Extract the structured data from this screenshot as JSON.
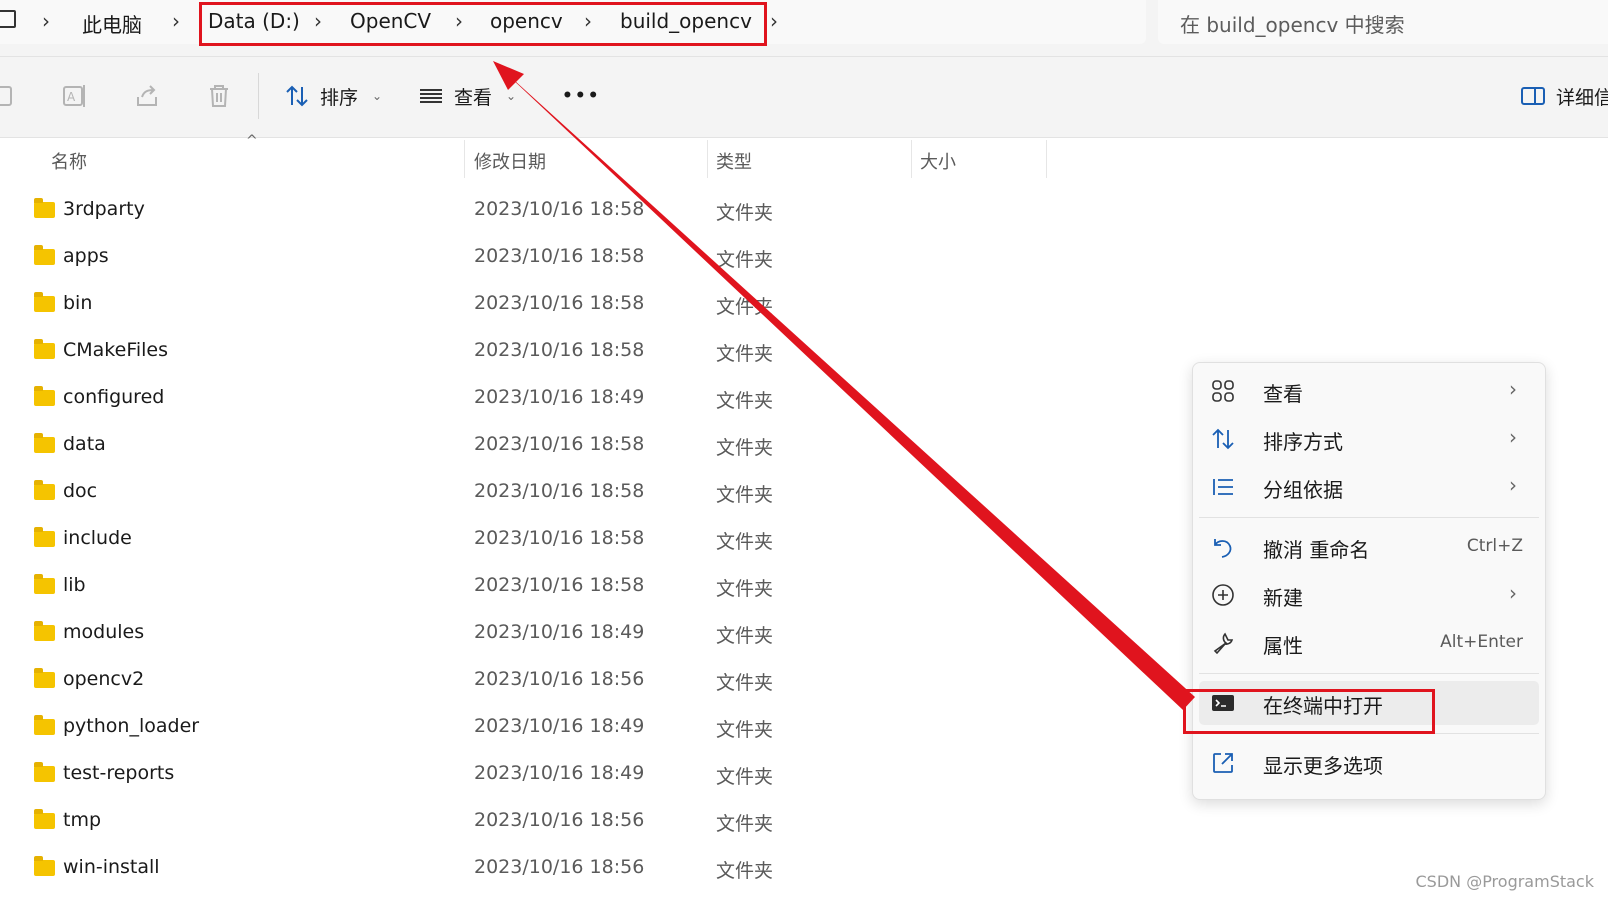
{
  "breadcrumb": {
    "root": "此电脑",
    "items": [
      "Data (D:)",
      "OpenCV",
      "opencv",
      "build_opencv"
    ]
  },
  "search": {
    "placeholder": "在 build_opencv 中搜索"
  },
  "toolbar": {
    "sort_label": "排序",
    "view_label": "查看",
    "more_label": "•••",
    "details_label": "详细信息"
  },
  "columns": {
    "name": "名称",
    "date": "修改日期",
    "type": "类型",
    "size": "大小"
  },
  "files": [
    {
      "name": "3rdparty",
      "date": "2023/10/16 18:58",
      "type": "文件夹"
    },
    {
      "name": "apps",
      "date": "2023/10/16 18:58",
      "type": "文件夹"
    },
    {
      "name": "bin",
      "date": "2023/10/16 18:58",
      "type": "文件夹"
    },
    {
      "name": "CMakeFiles",
      "date": "2023/10/16 18:58",
      "type": "文件夹"
    },
    {
      "name": "configured",
      "date": "2023/10/16 18:49",
      "type": "文件夹"
    },
    {
      "name": "data",
      "date": "2023/10/16 18:58",
      "type": "文件夹"
    },
    {
      "name": "doc",
      "date": "2023/10/16 18:58",
      "type": "文件夹"
    },
    {
      "name": "include",
      "date": "2023/10/16 18:58",
      "type": "文件夹"
    },
    {
      "name": "lib",
      "date": "2023/10/16 18:58",
      "type": "文件夹"
    },
    {
      "name": "modules",
      "date": "2023/10/16 18:49",
      "type": "文件夹"
    },
    {
      "name": "opencv2",
      "date": "2023/10/16 18:56",
      "type": "文件夹"
    },
    {
      "name": "python_loader",
      "date": "2023/10/16 18:49",
      "type": "文件夹"
    },
    {
      "name": "test-reports",
      "date": "2023/10/16 18:49",
      "type": "文件夹"
    },
    {
      "name": "tmp",
      "date": "2023/10/16 18:56",
      "type": "文件夹"
    },
    {
      "name": "win-install",
      "date": "2023/10/16 18:56",
      "type": "文件夹"
    }
  ],
  "context_menu": {
    "view": "查看",
    "sort_by": "排序方式",
    "group_by": "分组依据",
    "undo": "撤消 重命名",
    "undo_shortcut": "Ctrl+Z",
    "new": "新建",
    "properties": "属性",
    "properties_shortcut": "Alt+Enter",
    "open_terminal": "在终端中打开",
    "show_more": "显示更多选项"
  },
  "annotation_color": "#e0141e",
  "folder_color": "#f5c400",
  "watermark": "CSDN @ProgramStack"
}
